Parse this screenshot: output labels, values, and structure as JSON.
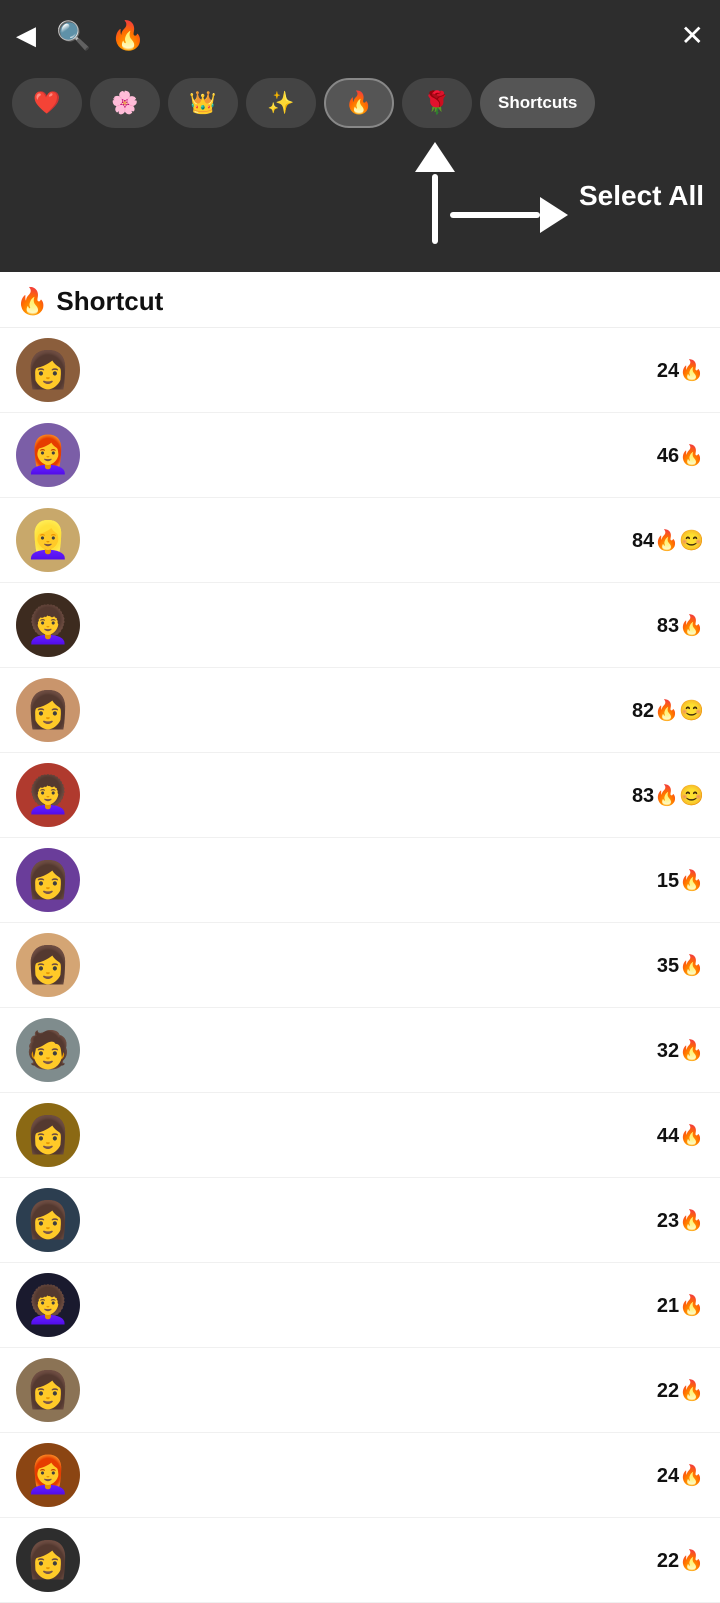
{
  "header": {
    "back_icon": "◀",
    "search_icon": "🔍",
    "fire_icon": "🔥",
    "close_icon": "✕"
  },
  "filter_tabs": [
    {
      "id": "heart",
      "emoji": "❤️",
      "active": false
    },
    {
      "id": "flower",
      "emoji": "🌸",
      "active": false
    },
    {
      "id": "crown",
      "emoji": "👑",
      "active": false
    },
    {
      "id": "sparkle",
      "emoji": "✨",
      "active": false
    },
    {
      "id": "fire",
      "emoji": "🔥",
      "active": true
    },
    {
      "id": "rose",
      "emoji": "🌹",
      "active": false
    }
  ],
  "shortcuts_button": "Shortcuts",
  "annotation": {
    "select_all": "Select All"
  },
  "section": {
    "icon": "🔥",
    "title": "Shortcut"
  },
  "friends": [
    {
      "id": 1,
      "streak": 24,
      "extra": "🔥",
      "color": "av-brown"
    },
    {
      "id": 2,
      "streak": 46,
      "extra": "🔥",
      "color": "av-purple"
    },
    {
      "id": 3,
      "streak": 84,
      "extra": "🔥😊",
      "color": "av-blonde"
    },
    {
      "id": 4,
      "streak": 83,
      "extra": "🔥",
      "color": "av-dark"
    },
    {
      "id": 5,
      "streak": 82,
      "extra": "🔥😊",
      "color": "av-tan"
    },
    {
      "id": 6,
      "streak": 83,
      "extra": "🔥😊",
      "color": "av-red"
    },
    {
      "id": 7,
      "streak": 15,
      "extra": "🔥",
      "color": "av-colorful"
    },
    {
      "id": 8,
      "streak": 35,
      "extra": "🔥",
      "color": "av-light"
    },
    {
      "id": 9,
      "streak": 32,
      "extra": "🔥",
      "color": "av-gray"
    },
    {
      "id": 10,
      "streak": 44,
      "extra": "🔥",
      "color": "av-bun"
    },
    {
      "id": 11,
      "streak": 23,
      "extra": "🔥",
      "color": "av-mask"
    },
    {
      "id": 12,
      "streak": 21,
      "extra": "🔥",
      "color": "av-black"
    },
    {
      "id": 13,
      "streak": 22,
      "extra": "🔥",
      "color": "av-medium"
    },
    {
      "id": 14,
      "streak": 24,
      "extra": "🔥",
      "color": "av-auburn"
    },
    {
      "id": 15,
      "streak": 22,
      "extra": "🔥",
      "color": "av-dark2"
    }
  ],
  "avatars": [
    "👩",
    "👩‍🦰",
    "👱‍♀️",
    "👩‍🦱",
    "👩",
    "👩‍🦱",
    "👩",
    "👩",
    "🧑",
    "👩",
    "👩",
    "👩‍🦱",
    "👩",
    "👩‍🦰",
    "👩"
  ]
}
